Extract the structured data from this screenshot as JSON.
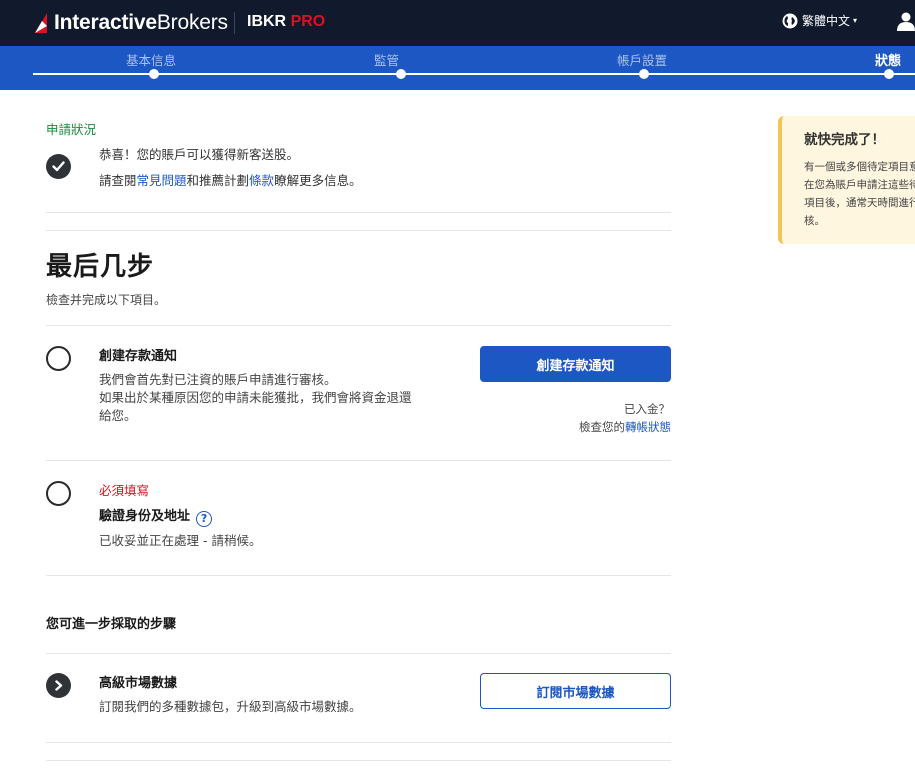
{
  "header": {
    "brand_bold": "Interactive",
    "brand_light": "Brokers",
    "product_prefix": "IBKR ",
    "product_suffix": "PRO",
    "language": "繁體中文",
    "caret": "▾"
  },
  "stepper": {
    "steps": [
      {
        "label": "基本信息"
      },
      {
        "label": "監管"
      },
      {
        "label": "帳戶設置"
      },
      {
        "label": "狀態"
      }
    ]
  },
  "status": {
    "title": "申請狀況",
    "congrats": "恭喜！您的賬戶可以獲得新客送股。",
    "faq_prefix": "請查閱",
    "faq_link": "常見問題",
    "faq_mid": "和推薦計劃",
    "terms_link": "條款",
    "faq_suffix": "瞭解更多信息。"
  },
  "final_steps": {
    "title": "最后几步",
    "subtitle": "檢查并完成以下項目。",
    "deposit": {
      "title": "創建存款通知",
      "desc_1": "我們會首先對已注資的賬戶申請進行審核。",
      "desc_2": "如果出於某種原因您的申請未能獲批，我們會將資金退還",
      "desc_3": "給您。",
      "button": "創建存款通知",
      "funded_question": "已入金？",
      "check_prefix": "檢查您的",
      "check_link": "轉帳狀態"
    },
    "identity": {
      "required": "必須填寫",
      "title": "驗證身份及地址",
      "help": "?",
      "desc": "已收妥並正在處理 - 請稍候。"
    }
  },
  "further_steps": {
    "title": "您可進一步採取的步驟",
    "market_data": {
      "title": "高級市場數據",
      "desc": "訂閱我們的多種數據包，升級到高級市場數據。",
      "button": "訂閱市場數據"
    }
  },
  "notice": {
    "title": "就快完成了！",
    "body": "有一個或多個待定項目意。在您為賬戶申請注這些待定項目後，通常天時間進行審核。"
  }
}
